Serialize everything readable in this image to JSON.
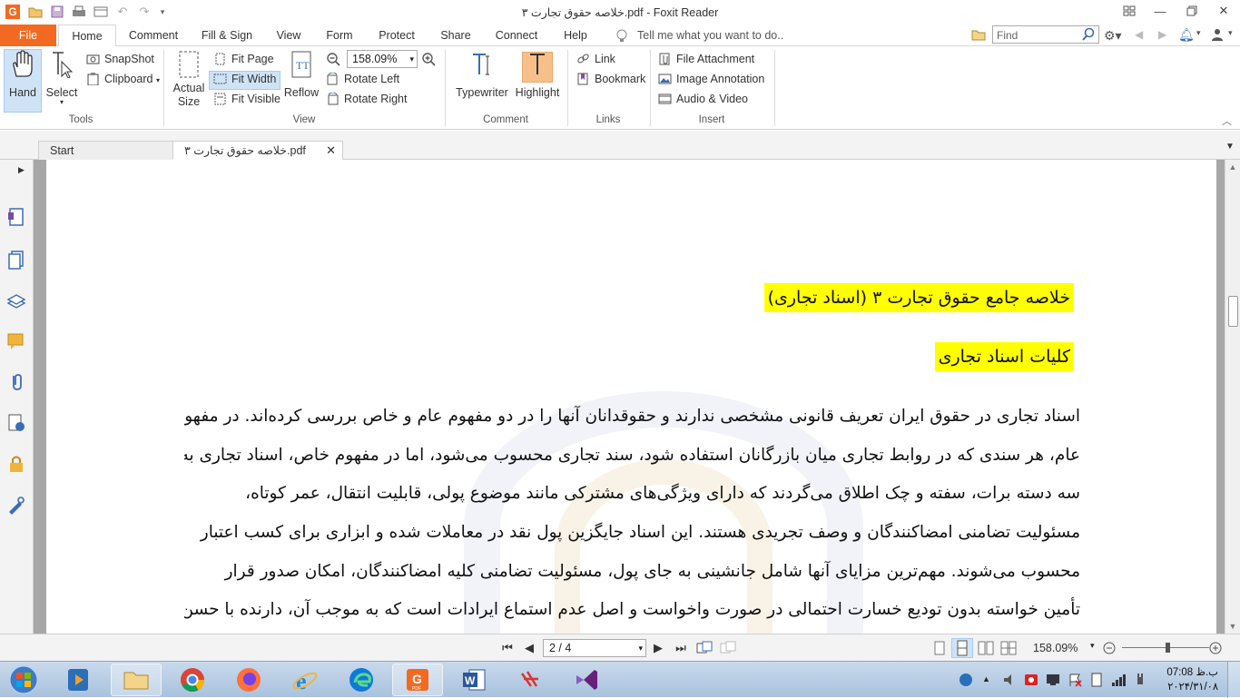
{
  "window": {
    "title": "خلاصه حقوق تجارت ۳.pdf - Foxit Reader"
  },
  "menu": {
    "file": "File",
    "home": "Home",
    "comment": "Comment",
    "fill_sign": "Fill & Sign",
    "view": "View",
    "form": "Form",
    "protect": "Protect",
    "share": "Share",
    "connect": "Connect",
    "help": "Help",
    "tell_me": "Tell me what you want to do..",
    "find_placeholder": "Find"
  },
  "ribbon": {
    "tools": {
      "hand": "Hand",
      "select": "Select",
      "snapshot": "SnapShot",
      "clipboard": "Clipboard",
      "label": "Tools"
    },
    "view": {
      "actual_size_1": "Actual",
      "actual_size_2": "Size",
      "fit_page": "Fit Page",
      "fit_width": "Fit Width",
      "fit_visible": "Fit Visible",
      "reflow": "Reflow",
      "zoom": "158.09%",
      "rotate_left": "Rotate Left",
      "rotate_right": "Rotate Right",
      "label": "View"
    },
    "comment": {
      "typewriter": "Typewriter",
      "highlight": "Highlight",
      "label": "Comment"
    },
    "links": {
      "link": "Link",
      "bookmark": "Bookmark",
      "label": "Links"
    },
    "insert": {
      "file_attachment": "File Attachment",
      "image_annotation": "Image Annotation",
      "audio_video": "Audio & Video",
      "label": "Insert"
    }
  },
  "tabs": {
    "start": "Start",
    "document": "خلاصه حقوق تجارت ۳.pdf"
  },
  "document": {
    "heading1": "خلاصه جامع حقوق تجارت ۳ (اسناد تجاری)",
    "heading2": "کلیات اسناد تجاری",
    "lines": [
      "اسناد تجاری در حقوق ایران تعریف قانونی مشخصی ندارند و حقوقدانان آنها را در دو مفهوم عام و خاص بررسی کرده‌اند. در مفهوم",
      "عام، هر سندی که در روابط تجاری میان بازرگانان استفاده شود، سند تجاری محسوب می‌شود، اما در مفهوم خاص، اسناد تجاری به",
      "سه دسته برات، سفته و چک اطلاق می‌گردند که دارای ویژگی‌های مشترکی مانند موضوع پولی، قابلیت انتقال، عمر کوتاه،",
      "مسئولیت تضامنی امضاکنندگان و وصف تجریدی هستند. این اسناد جایگزین پول نقد در معاملات شده و ابزاری برای کسب اعتبار",
      "محسوب می‌شوند. مهم‌ترین مزایای آنها شامل جانشینی به جای پول، مسئولیت تضامنی کلیه امضاکنندگان، امکان صدور قرار",
      "تأمین خواسته بدون تودیع خسارت احتمالی در صورت واخواست و اصل عدم استماع ایرادات است که به موجب آن، دارنده با حسن"
    ]
  },
  "status": {
    "page": "2 / 4",
    "zoom": "158.09%"
  },
  "taskbar": {
    "time": "07:08 ب.ظ",
    "date": "۲۰۲۴/۳۱/۰۸"
  },
  "colors": {
    "accent": "#f26a21",
    "highlight": "#ffff00",
    "selection": "#cfe3f7"
  }
}
